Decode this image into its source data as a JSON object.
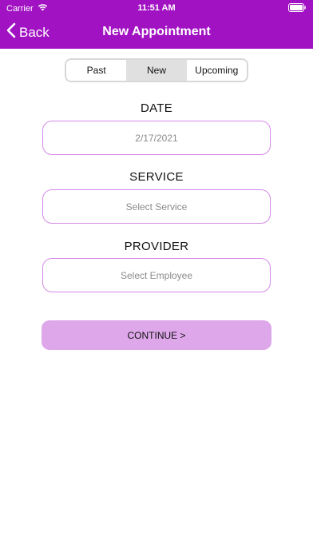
{
  "status_bar": {
    "carrier": "Carrier",
    "time": "11:51 AM"
  },
  "nav": {
    "back_label": "Back",
    "title": "New Appointment"
  },
  "tabs": [
    {
      "label": "Past",
      "selected": false
    },
    {
      "label": "New",
      "selected": true
    },
    {
      "label": "Upcoming",
      "selected": false
    }
  ],
  "date": {
    "label": "DATE",
    "value": "2/17/2021"
  },
  "service": {
    "label": "SERVICE",
    "placeholder": "Select Service"
  },
  "provider": {
    "label": "PROVIDER",
    "placeholder": "Select Employee"
  },
  "continue_label": "CONTINUE >",
  "colors": {
    "header": "#a112c2",
    "field_border": "#d58be8",
    "button": "#dea7ea",
    "selected_tab": "#e0e0e0"
  },
  "icons": {
    "wifi": "wifi-icon",
    "battery": "battery-icon",
    "back": "chevron-left-icon"
  }
}
